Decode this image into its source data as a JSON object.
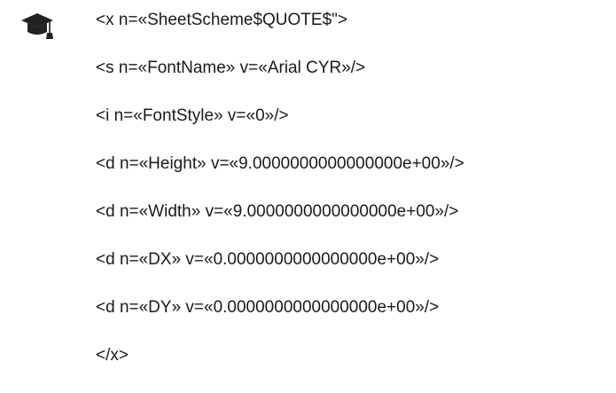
{
  "icon": "graduation-cap-icon",
  "lines": [
    "<x n=«SheetScheme$QUOTE$\">",
    "<s n=«FontName» v=«Arial CYR»/>",
    "<i n=«FontStyle» v=«0»/>",
    "<d n=«Height» v=«9.0000000000000000e+00»/>",
    "<d n=«Width» v=«9.0000000000000000e+00»/>",
    "<d n=«DX» v=«0.0000000000000000e+00»/>",
    "<d n=«DY» v=«0.0000000000000000e+00»/>",
    "</x>"
  ]
}
